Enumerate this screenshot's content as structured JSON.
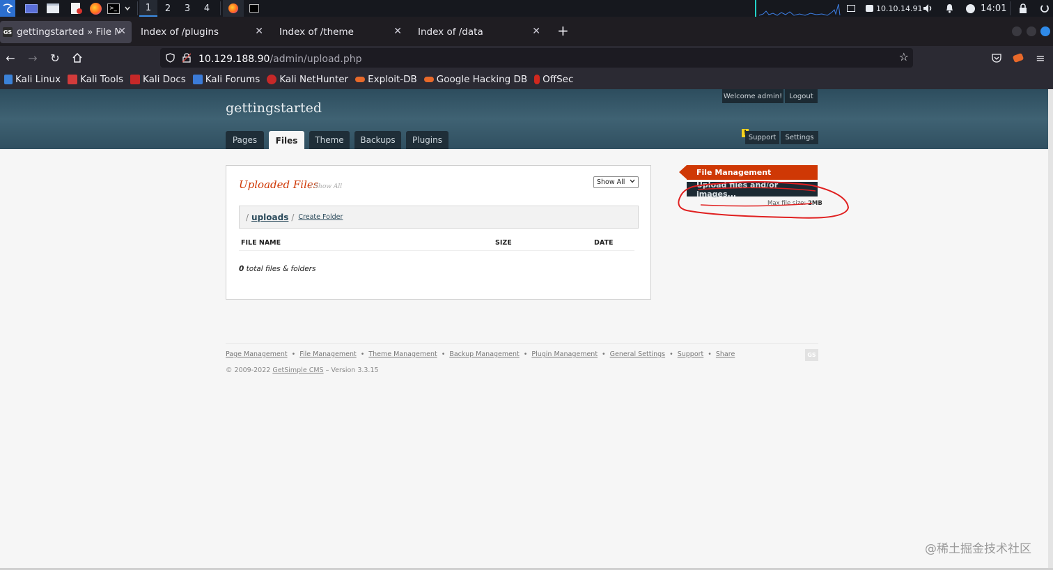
{
  "taskbar": {
    "workspaces": [
      "1",
      "2",
      "3",
      "4"
    ],
    "ip": "10.10.14.91",
    "clock": "14:01",
    "icons": [
      "kali-menu-icon",
      "desktop-icon",
      "files-icon",
      "text-editor-icon",
      "firefox-icon",
      "terminal-icon",
      "dropdown-icon"
    ]
  },
  "browser": {
    "tabs": [
      {
        "label": "gettingstarted » File Man",
        "active": true
      },
      {
        "label": "Index of /plugins"
      },
      {
        "label": "Index of /theme"
      },
      {
        "label": "Index of /data"
      }
    ],
    "url_host": "10.129.188.90",
    "url_path": "/admin/upload.php",
    "bookmarks": [
      "Kali Linux",
      "Kali Tools",
      "Kali Docs",
      "Kali Forums",
      "Kali NetHunter",
      "Exploit-DB",
      "Google Hacking DB",
      "OffSec"
    ]
  },
  "header": {
    "site_name": "gettingstarted",
    "welcome": "Welcome admin!",
    "logout": "Logout",
    "tabs": [
      "Pages",
      "Files",
      "Theme",
      "Backups",
      "Plugins"
    ],
    "active_tab": "Files",
    "support": "Support",
    "settings": "Settings"
  },
  "main": {
    "title": "Uploaded Files",
    "subtitle": "/ Show All",
    "filter": "Show All",
    "crumb_slash": "/",
    "crumb_folder": "uploads",
    "crumb_sep": "/",
    "create_folder": "Create Folder",
    "columns": [
      "FILE NAME",
      "SIZE",
      "DATE"
    ],
    "total_count": "0",
    "total_label": " total files & folders"
  },
  "sidebar": {
    "title": "File Management",
    "upload": "Upload files and/or images...",
    "max_label": "Max file size: ",
    "max_value": "2MB"
  },
  "footer": {
    "links": [
      "Page Management",
      "File Management",
      "Theme Management",
      "Backup Management",
      "Plugin Management",
      "General Settings",
      "Support",
      "Share"
    ],
    "copyright_prefix": "© 2009-2022 ",
    "copyright_link": "GetSimple CMS",
    "copyright_suffix": " – Version 3.3.15",
    "logo": "GS"
  },
  "watermark": "@稀土掘金技术社区",
  "colors": {
    "accent": "#cf3805",
    "header": "#3f6273",
    "dark": "#1c2a33"
  }
}
